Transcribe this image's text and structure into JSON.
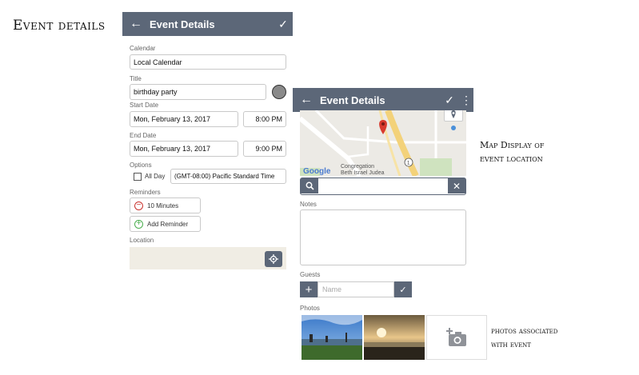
{
  "captions": {
    "main": "Event details",
    "map_line1": "Map Display of",
    "map_line2": "event location",
    "photos_line1": "photos associated",
    "photos_line2": "with event"
  },
  "screen1": {
    "appbar": {
      "title": "Event Details",
      "back_icon": "arrow-left-icon",
      "action_icon": "check-icon"
    },
    "calendar": {
      "label": "Calendar",
      "value": "Local Calendar"
    },
    "title_field": {
      "label": "Title",
      "value": "birthday party"
    },
    "start": {
      "label": "Start Date",
      "date": "Mon, February 13, 2017",
      "time": "8:00 PM"
    },
    "end": {
      "label": "End Date",
      "date": "Mon, February 13, 2017",
      "time": "9:00 PM"
    },
    "options": {
      "label": "Options",
      "all_day": "All Day",
      "timezone": "(GMT-08:00) Pacific Standard Time"
    },
    "reminders": {
      "label": "Reminders",
      "items": [
        "10 Minutes"
      ],
      "add_label": "Add Reminder"
    },
    "location": {
      "label": "Location"
    }
  },
  "screen2": {
    "appbar": {
      "title": "Event Details",
      "back_icon": "arrow-left-icon",
      "check_icon": "check-icon",
      "menu_icon": "more-vert-icon"
    },
    "map": {
      "logo": "Google",
      "place_line1": "Congregation",
      "place_line2": "Beth Israel Judea",
      "route": "1"
    },
    "notes_label": "Notes",
    "guests": {
      "label": "Guests",
      "placeholder": "Name"
    },
    "photos_label": "Photos"
  },
  "colors": {
    "appbar": "#5c6778",
    "map_bg": "#eceae5",
    "location_bg": "#f0ede4"
  }
}
